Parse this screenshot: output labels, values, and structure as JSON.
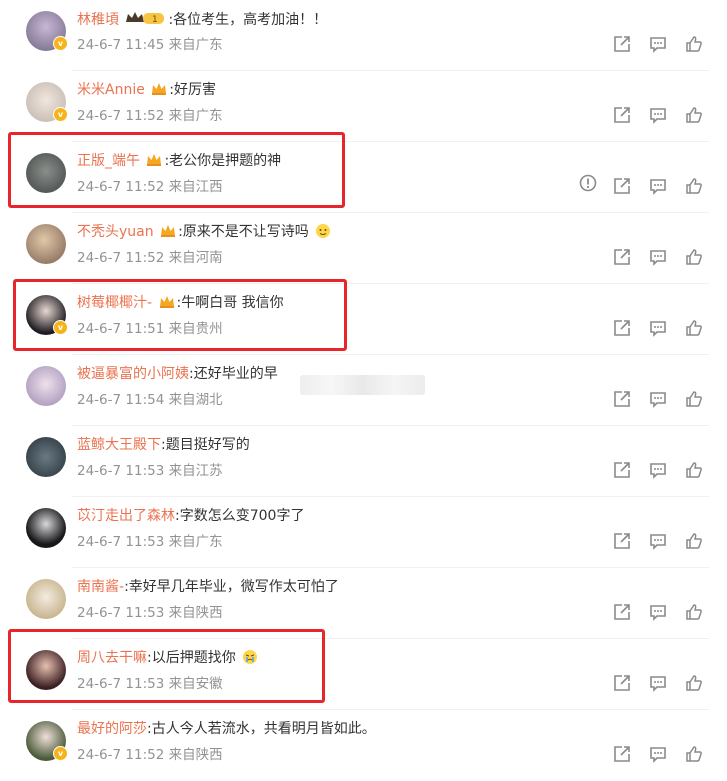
{
  "comments": [
    {
      "user": "林稚頃",
      "sep": ":",
      "text": "各位考生，高考加油！！",
      "date": "24-6-7 11:45",
      "location": "来自广东",
      "badge": "vip",
      "vip_level": "1",
      "avatar_color": "#8a7f9a"
    },
    {
      "user": "米米Annie",
      "sep": ":",
      "text": "好厉害",
      "date": "24-6-7 11:52",
      "location": "来自广东",
      "badge": "crown",
      "avatar_color": "#d6cfc8"
    },
    {
      "user": "正版_端午",
      "sep": ":",
      "text": "老公你是押题的神",
      "date": "24-6-7 11:52",
      "location": "来自江西",
      "badge": "crown",
      "avatar_color": "#4a4e50"
    },
    {
      "user": "不秃头yuan",
      "sep": ":",
      "text": "原来不是不让写诗吗",
      "date": "24-6-7 11:52",
      "location": "来自河南",
      "badge": "crown",
      "avatar_color": "#a58b7a"
    },
    {
      "user": "树莓椰椰汁-",
      "sep": ":",
      "text": "牛啊白哥 我信你",
      "date": "24-6-7 11:51",
      "location": "来自贵州",
      "badge": "crown",
      "avatar_color": "#2c2a30"
    },
    {
      "user": "被逼暴富的小阿姨",
      "sep": ":",
      "text": "还好毕业的早",
      "date": "24-6-7 11:54",
      "location": "来自湖北",
      "badge": "",
      "avatar_color": "#b8a8c8"
    },
    {
      "user": "蓝鲸大王殿下",
      "sep": ":",
      "text": "题目挺好写的",
      "date": "24-6-7 11:53",
      "location": "来自江苏",
      "badge": "",
      "avatar_color": "#3a4a52"
    },
    {
      "user": "苡汀走出了森林",
      "sep": ":",
      "text": "字数怎么变700字了",
      "date": "24-6-7 11:53",
      "location": "来自广东",
      "badge": "",
      "avatar_color": "#2a2a2e"
    },
    {
      "user": "南南酱-",
      "sep": ":",
      "text": "幸好早几年毕业，微写作太可怕了",
      "date": "24-6-7 11:53",
      "location": "来自陕西",
      "badge": "",
      "avatar_color": "#c9b7a0"
    },
    {
      "user": "周八去干嘛",
      "sep": ":",
      "text": "以后押题找你",
      "date": "24-6-7 11:53",
      "location": "来自安徽",
      "badge": "",
      "avatar_color": "#5a3a3a"
    },
    {
      "user": "最好的阿莎",
      "sep": ":",
      "text": "古人今人若流水，共看明月皆如此。",
      "date": "24-6-7 11:52",
      "location": "来自陕西",
      "badge": "",
      "avatar_color": "#7a8a6a"
    }
  ],
  "colors": {
    "username": "#eb7350",
    "meta": "#939393",
    "highlight": "#e8252b",
    "icon": "#8a8a8a"
  },
  "icons": [
    "share-icon",
    "comment-icon",
    "like-icon",
    "report-icon",
    "crown-icon"
  ]
}
